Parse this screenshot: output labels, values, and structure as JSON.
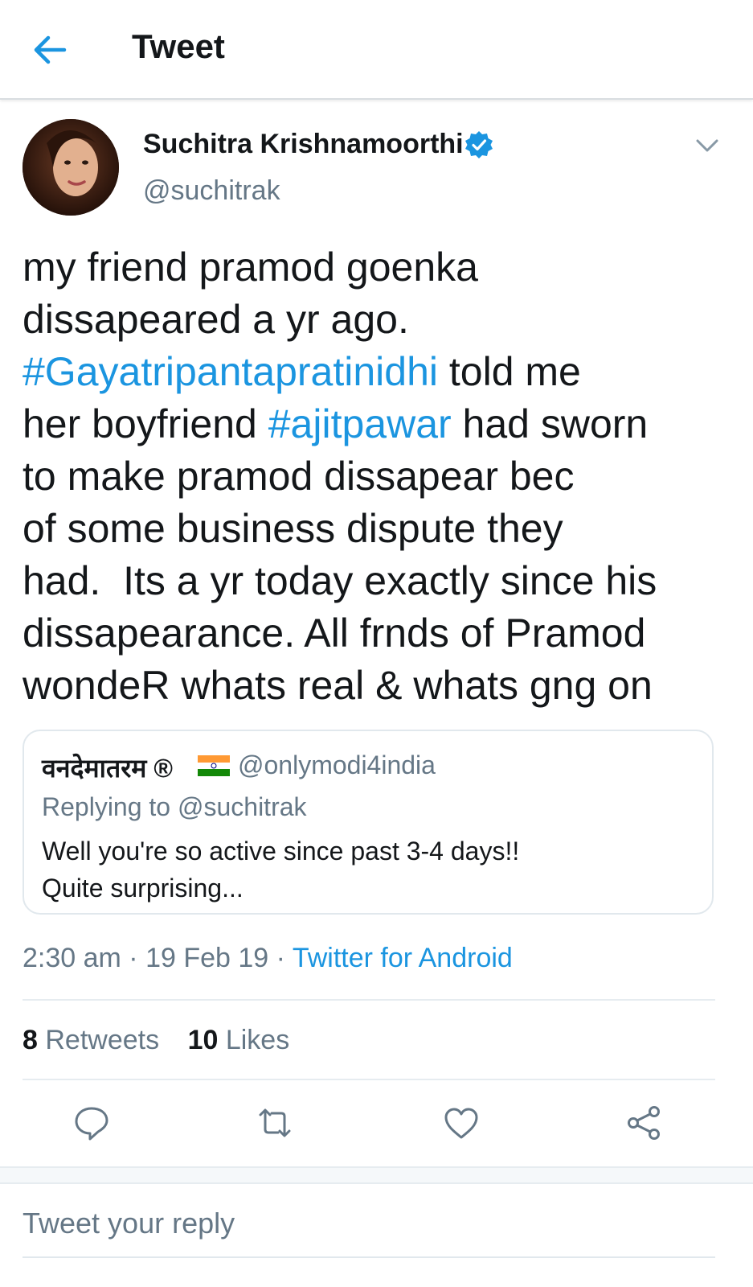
{
  "header": {
    "title": "Tweet"
  },
  "author": {
    "name": "Suchitra Krishnamoorthi",
    "handle": "@suchitrak"
  },
  "tweet": {
    "lines": [
      [
        {
          "t": "my friend pramod goenka"
        }
      ],
      [
        {
          "t": "dissapeared a yr ago."
        }
      ],
      [
        {
          "t": "#Gayatripantapratinidhi",
          "tag": true
        },
        {
          "t": " told me"
        }
      ],
      [
        {
          "t": "her boyfriend "
        },
        {
          "t": "#ajitpawar",
          "tag": true
        },
        {
          "t": " had sworn"
        }
      ],
      [
        {
          "t": "to make pramod dissapear bec"
        }
      ],
      [
        {
          "t": "of some business dispute they"
        }
      ],
      [
        {
          "t": "had.  Its a yr today exactly since his"
        }
      ],
      [
        {
          "t": "dissapearance. All frnds of Pramod"
        }
      ],
      [
        {
          "t": "wondeR whats real & whats gng on"
        }
      ]
    ]
  },
  "quoted": {
    "name": "वनदेमातरम ®",
    "handle": "@onlymodi4india",
    "replying_to": "Replying to @suchitrak",
    "text_line1": "Well you're so active since past 3-4 days!!",
    "text_line2": "Quite surprising..."
  },
  "meta": {
    "time": "2:30 am",
    "date": "19 Feb 19",
    "source": "Twitter for Android",
    "sep": " · "
  },
  "stats": {
    "retweets_count": "8",
    "retweets_label": "Retweets",
    "likes_count": "10",
    "likes_label": "Likes"
  },
  "reply": {
    "placeholder": "Tweet your reply"
  },
  "colors": {
    "link": "#1b95e0",
    "secondary": "#657786",
    "primary_text": "#14171a",
    "border": "#e6ecf0"
  },
  "icons": [
    "back-arrow-icon",
    "verified-badge-icon",
    "chevron-down-icon",
    "reply-icon",
    "retweet-icon",
    "like-icon",
    "share-icon",
    "india-flag-icon"
  ]
}
